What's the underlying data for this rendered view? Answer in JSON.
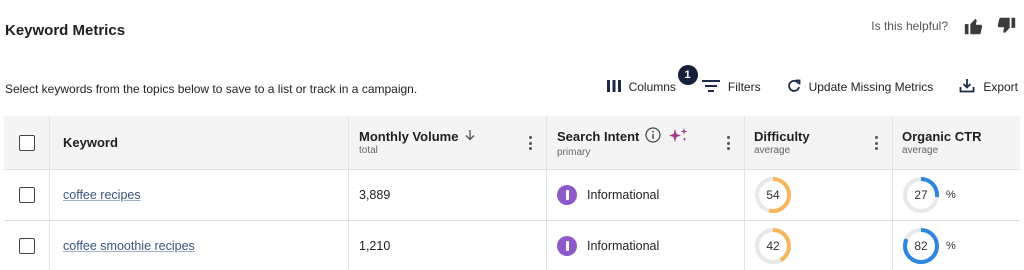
{
  "header": {
    "title": "Keyword Metrics",
    "helpful_label": "Is this helpful?",
    "thumb_up_icon": "thumbs-up-icon",
    "thumb_down_icon": "thumbs-down-icon"
  },
  "subtitle": "Select keywords from the topics below to save to a list or track in a campaign.",
  "toolbar": {
    "columns_label": "Columns",
    "columns_badge": "1",
    "filters_label": "Filters",
    "update_label": "Update Missing Metrics",
    "export_label": "Export"
  },
  "table": {
    "columns": {
      "keyword": {
        "label": "Keyword"
      },
      "volume": {
        "label": "Monthly Volume",
        "sub": "total"
      },
      "intent": {
        "label": "Search Intent",
        "sub": "primary"
      },
      "difficulty": {
        "label": "Difficulty",
        "sub": "average"
      },
      "ctr": {
        "label": "Organic CTR",
        "sub": "average"
      }
    },
    "rows": [
      {
        "keyword": "coffee recipes",
        "volume": "3,889",
        "intent": "Informational",
        "difficulty": "54",
        "ctr": "27",
        "ctr_unit": "%"
      },
      {
        "keyword": "coffee smoothie recipes",
        "volume": "1,210",
        "intent": "Informational",
        "difficulty": "42",
        "ctr": "82",
        "ctr_unit": "%"
      }
    ]
  },
  "colors": {
    "difficulty_arc": "#f5b65e",
    "ctr_arc": "#2e86de",
    "track": "#e8e8e8",
    "intent_informational": "#8c5bc9",
    "sparkle": "#a23b8f",
    "badge": "#17203a"
  }
}
